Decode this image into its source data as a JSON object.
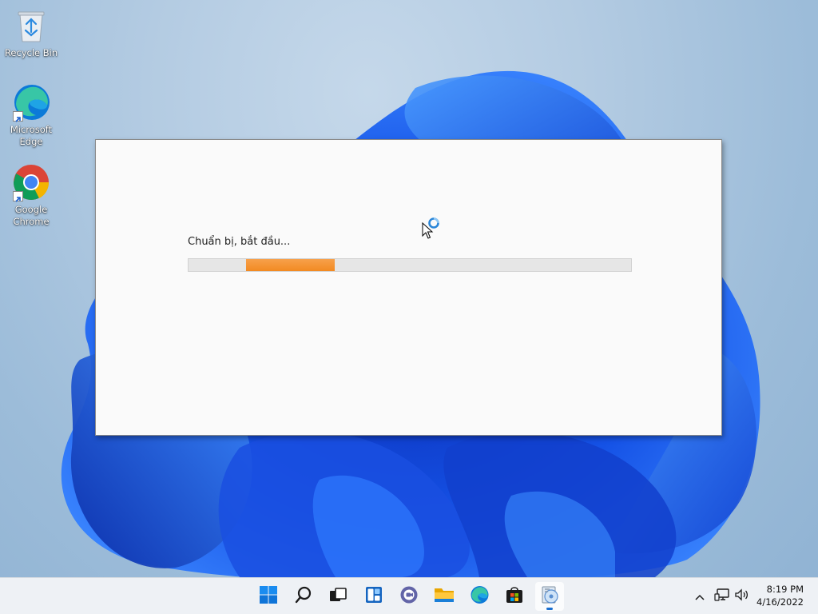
{
  "desktop": {
    "icons": [
      {
        "label": "Recycle Bin",
        "icon": "recycle-bin-icon"
      },
      {
        "label": "Microsoft Edge",
        "icon": "edge-icon"
      },
      {
        "label": "Google Chrome",
        "icon": "chrome-icon"
      }
    ]
  },
  "dialog": {
    "status": "Chuẩn bị, bắt đầu...",
    "progress_color": "#f28a22",
    "progress_state": "indeterminate"
  },
  "taskbar": {
    "apps": [
      {
        "name": "start",
        "icon": "windows-start-icon"
      },
      {
        "name": "search",
        "icon": "search-icon"
      },
      {
        "name": "task-view",
        "icon": "task-view-icon"
      },
      {
        "name": "widgets",
        "icon": "widgets-icon"
      },
      {
        "name": "chat",
        "icon": "teams-chat-icon"
      },
      {
        "name": "file-explorer",
        "icon": "folder-icon"
      },
      {
        "name": "edge",
        "icon": "edge-icon"
      },
      {
        "name": "store",
        "icon": "store-icon"
      },
      {
        "name": "installer",
        "icon": "installer-icon",
        "active": true
      }
    ],
    "tray": {
      "chevron_icon": "chevron-up-icon",
      "network_icon": "network-icon",
      "volume_icon": "volume-icon"
    },
    "clock": {
      "time": "8:19 PM",
      "date": "4/16/2022"
    }
  },
  "colors": {
    "accent": "#0067c0",
    "wallpaper_bloom": "#1a5fe0"
  }
}
